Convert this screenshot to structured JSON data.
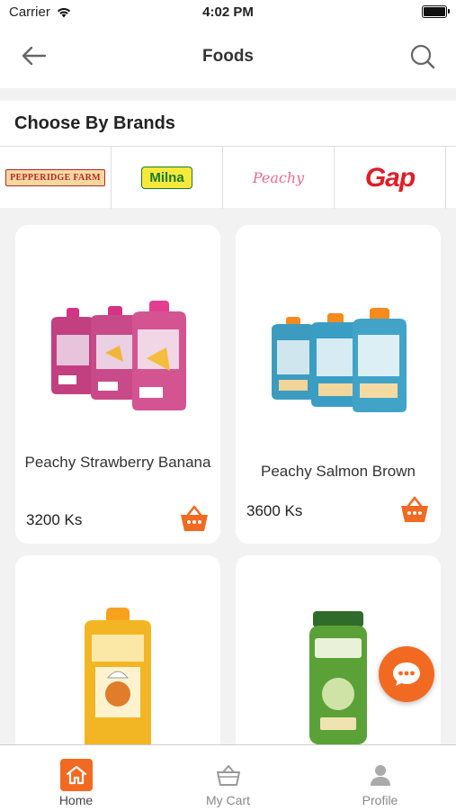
{
  "status_bar": {
    "carrier": "Carrier",
    "time": "4:02 PM"
  },
  "header": {
    "title": "Foods",
    "back_icon": "arrow-left-icon",
    "search_icon": "search-icon"
  },
  "brands": {
    "title": "Choose By Brands",
    "items": [
      {
        "name": "PEPPERIDGE FARM"
      },
      {
        "name": "Milna"
      },
      {
        "name": "Peachy"
      },
      {
        "name": "Gap"
      }
    ]
  },
  "products": [
    {
      "name": "Peachy Strawberry Banana",
      "price": "3200 Ks"
    },
    {
      "name": "Peachy Salmon Brown",
      "price": "3600 Ks"
    },
    {
      "name": "",
      "price": ""
    },
    {
      "name": "",
      "price": ""
    }
  ],
  "tabs": [
    {
      "label": "Home",
      "icon": "home-icon",
      "active": true
    },
    {
      "label": "My Cart",
      "icon": "basket-icon",
      "active": false
    },
    {
      "label": "Profile",
      "icon": "person-icon",
      "active": false
    }
  ],
  "colors": {
    "accent": "#f26a21",
    "background": "#f2f2f2"
  }
}
